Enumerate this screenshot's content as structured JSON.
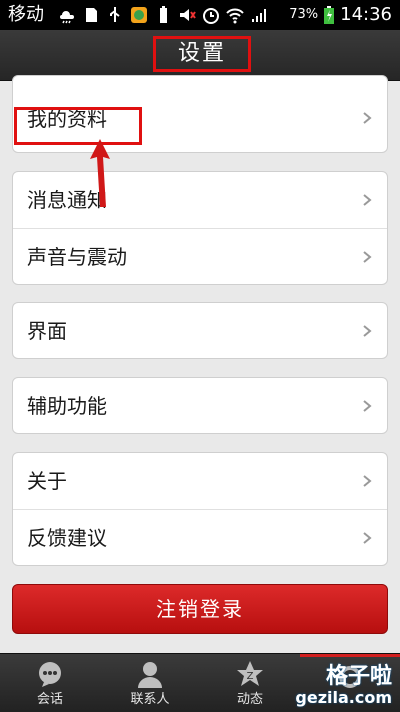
{
  "status_bar": {
    "carrier": "移动",
    "battery": "73%",
    "time": "14:36"
  },
  "header": {
    "title": "设置"
  },
  "groups": {
    "profile": [
      "我的资料"
    ],
    "notify": [
      "消息通知",
      "声音与震动"
    ],
    "ui": [
      "界面"
    ],
    "accessibility": [
      "辅助功能"
    ],
    "about": [
      "关于",
      "反馈建议"
    ]
  },
  "logout_label": "注销登录",
  "tabbar": {
    "items": [
      {
        "label": "会话",
        "icon": "chat-bubble-icon"
      },
      {
        "label": "联系人",
        "icon": "contacts-icon"
      },
      {
        "label": "动态",
        "icon": "star-feed-icon"
      },
      {
        "label": "",
        "icon": "settings-icon"
      }
    ]
  },
  "watermark": {
    "line1": "格子啦",
    "line2": "gezila.com"
  },
  "colors": {
    "accent_red": "#d21f1f",
    "annotation_red": "#e01010"
  }
}
